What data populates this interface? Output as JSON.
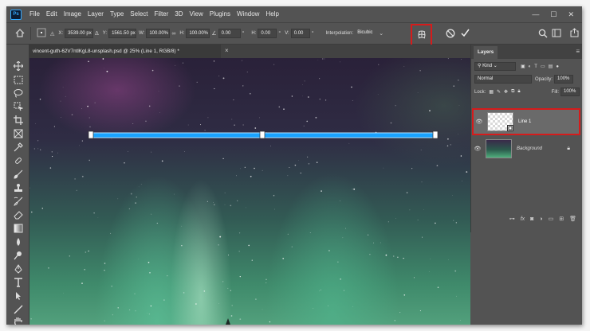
{
  "app": {
    "logo": "Ps"
  },
  "menu": [
    "File",
    "Edit",
    "Image",
    "Layer",
    "Type",
    "Select",
    "Filter",
    "3D",
    "View",
    "Plugins",
    "Window",
    "Help"
  ],
  "window_controls": {
    "minimize": "—",
    "maximize": "☐",
    "close": "✕"
  },
  "options_bar": {
    "x_label": "X:",
    "x_value": "3539.00 px",
    "y_label": "Y:",
    "y_value": "1561.50 px",
    "w_label": "W:",
    "w_value": "100.00%",
    "h_label": "H:",
    "h_value": "100.00%",
    "angle_value": "0.00",
    "angle_unit": "°",
    "hskew_label": "H:",
    "hskew_value": "0.00",
    "vskew_label": "V:",
    "vskew_value": "0.00",
    "skew_unit": "°",
    "interp_label": "Interpolation:",
    "interp_value": "Bicubic"
  },
  "document_tab": {
    "title": "vincent-guth-62V7ntlKgL8-unsplash.psd @ 25% (Line 1, RGB/8) *",
    "close": "×"
  },
  "layers_panel": {
    "tab_label": "Layers",
    "filter_value": "Kind",
    "blend_mode": "Normal",
    "opacity_label": "Opacity:",
    "opacity_value": "100%",
    "lock_label": "Lock:",
    "fill_label": "Fill:",
    "fill_value": "100%",
    "layers": [
      {
        "name": "Line 1",
        "selected": true
      },
      {
        "name": "Background",
        "selected": false
      }
    ]
  },
  "colors": {
    "accent_blue": "#1aa3ff",
    "highlight_red": "#d61b1b",
    "ui_gray": "#535353"
  }
}
